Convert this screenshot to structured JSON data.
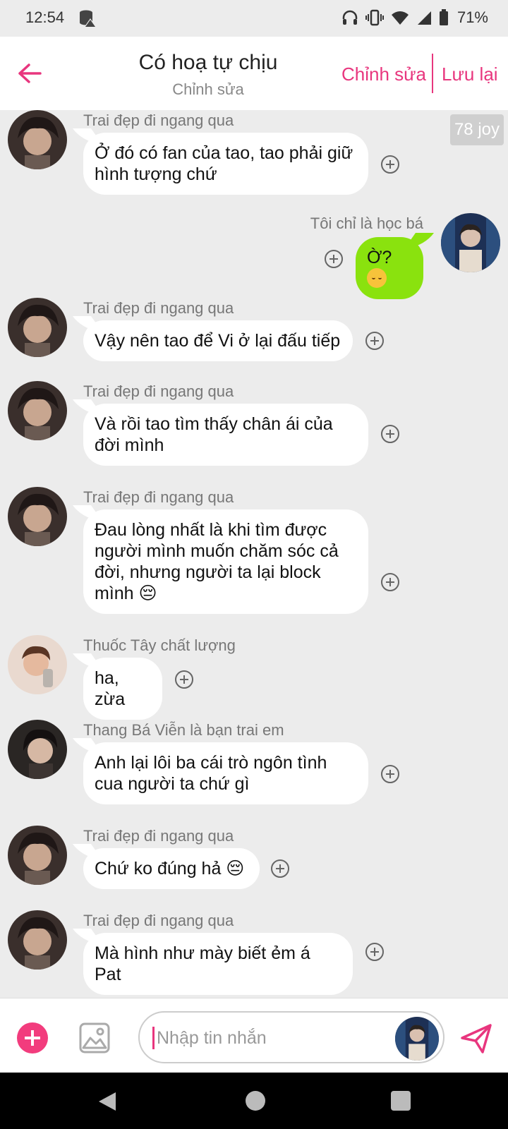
{
  "status_bar": {
    "time": "12:54",
    "battery": "71%"
  },
  "header": {
    "title": "Có hoạ tự chịu",
    "subtitle": "Chỉnh sửa",
    "edit_label": "Chỉnh sửa",
    "save_label": "Lưu lại"
  },
  "chat": {
    "joy_badge": "78 joy",
    "messages": [
      {
        "sender": "Trai đẹp đi ngang qua",
        "text": "Ở đó có fan của tao, tao phải giữ hình tượng chứ"
      },
      {
        "sender": "Tôi chỉ là học bá",
        "text": "Ờ? 🙃",
        "mine": true
      },
      {
        "sender": "Trai đẹp đi ngang qua",
        "text": "Vậy nên tao để Vi ở lại đấu tiếp"
      },
      {
        "sender": "Trai đẹp đi ngang qua",
        "text": "Và rồi tao tìm thấy chân ái của đời mình"
      },
      {
        "sender": "Trai đẹp đi ngang qua",
        "text": "Đau lòng nhất là khi tìm được người mình muốn chăm sóc cả đời, nhưng người ta lại block mình 😔"
      },
      {
        "sender": "Thuốc Tây chất lượng",
        "text": "ha, zừa"
      },
      {
        "sender": "Thang Bá Viễn là bạn trai em",
        "text": "Anh lại lôi ba cái trò ngôn tình cua người ta chứ gì"
      },
      {
        "sender": "Trai đẹp đi ngang qua",
        "text": "Chứ ko đúng hả 😔"
      },
      {
        "sender": "Trai đẹp đi ngang qua",
        "text": "Mà hình như mày biết ẻm á Pat"
      }
    ]
  },
  "composer": {
    "placeholder": "Nhập tin nhắn"
  },
  "colors": {
    "accent": "#e8367e",
    "my_bubble": "#8ae20e",
    "add_button": "#f23c7d"
  }
}
